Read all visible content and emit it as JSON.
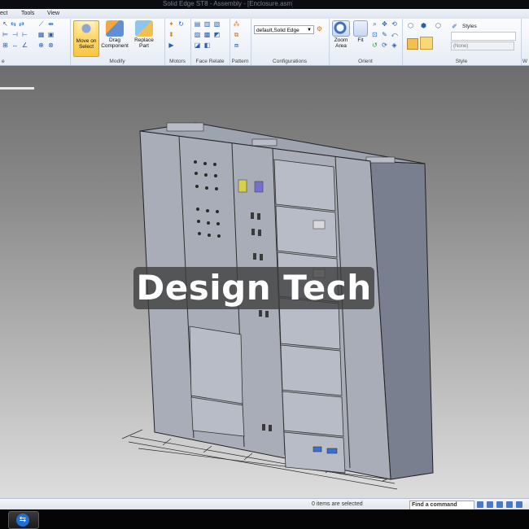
{
  "titlebar": {
    "title": "Solid Edge ST8 - Assembly - [Enclosure.asm]"
  },
  "menu": {
    "items": [
      "ect",
      "Tools",
      "View"
    ]
  },
  "ribbon": {
    "move_on_select": "Move on Select",
    "drag_component": "Drag Component",
    "replace_part": "Replace Part",
    "configuration_value": "default,Solid Edge",
    "zoom_area": "Zoom Area",
    "fit": "Fit",
    "styles_label": "Styles",
    "styles_value": "(None)",
    "groups": [
      "e",
      "Modify",
      "Motors",
      "Face Relate",
      "Pattern",
      "Configurations",
      "Orient",
      "Style",
      "W"
    ]
  },
  "watermark": {
    "text": "Design Tech"
  },
  "statusbar": {
    "selection": "0 items are selected",
    "find_command": "Find a command"
  },
  "colors": {
    "accent": "#f9c542",
    "ribbon_icon": "#2a5fae",
    "taskbar_icon": "#1f6fd6"
  }
}
